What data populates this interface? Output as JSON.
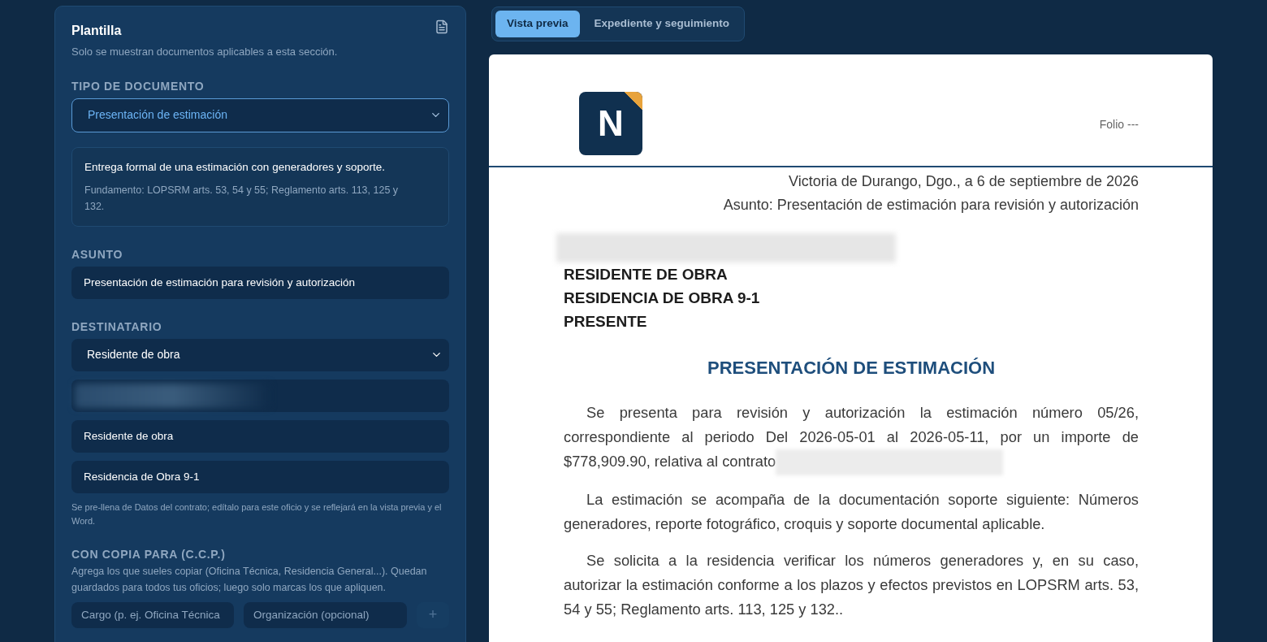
{
  "template_panel": {
    "title": "Plantilla",
    "subtitle": "Solo se muestran documentos aplicables a esta sección.",
    "document_type": {
      "label": "TIPO DE DOCUMENTO",
      "value": "Presentación de estimación"
    },
    "description": {
      "summary": "Entrega formal de una estimación con generadores y soporte.",
      "basis": "Fundamento: LOPSRM arts. 53, 54 y 55; Reglamento arts. 113, 125 y 132."
    },
    "subject": {
      "label": "ASUNTO",
      "value": "Presentación de estimación para revisión y autorización"
    },
    "recipient": {
      "label": "DESTINATARIO",
      "select_value": "Residente de obra",
      "fields": [
        {
          "kind": "redacted"
        },
        {
          "kind": "text",
          "value": "Residente de obra"
        },
        {
          "kind": "text",
          "value": "Residencia de Obra 9-1"
        }
      ],
      "help": "Se pre-llena de Datos del contrato; edítalo para este oficio y se reflejará en la vista previa y el Word."
    },
    "cc": {
      "label": "CON COPIA PARA (C.C.P.)",
      "help": "Agrega los que sueles copiar (Oficina Técnica, Residencia General...). Quedan guardados para todos tus oficios; luego solo marcas los que apliquen.",
      "role_placeholder": "Cargo (p. ej. Oficina Técnica",
      "org_placeholder": "Organización (opcional)",
      "add_button": "+"
    }
  },
  "tabs": [
    {
      "label": "Vista previa",
      "selected": true
    },
    {
      "label": "Expediente y seguimiento",
      "selected": false
    }
  ],
  "document": {
    "logo_letter": "N",
    "folio": "Folio ---",
    "place_date": "Victoria de Durango, Dgo., a 6 de septiembre de 2026",
    "subject_line": "Asunto: Presentación de estimación para revisión y autorización",
    "addressee": [
      {
        "kind": "redacted"
      },
      {
        "kind": "text",
        "text": "RESIDENTE DE OBRA"
      },
      {
        "kind": "text",
        "text": "RESIDENCIA DE OBRA 9-1"
      },
      {
        "kind": "text",
        "text": "PRESENTE"
      }
    ],
    "heading": "PRESENTACIÓN DE ESTIMACIÓN",
    "paragraphs": [
      {
        "text": "Se presenta para revisión y autorización la estimación número 05/26, correspondiente al periodo Del 2026-05-01 al 2026-05-11, por un importe de $778,909.90, relativa al contrato",
        "redacted_tail": true
      },
      {
        "text": "La estimación se acompaña de la documentación soporte siguiente: Números generadores, reporte fotográfico, croquis y soporte documental aplicable.",
        "redacted_tail": false
      },
      {
        "text": "Se solicita a la residencia verificar los números generadores y, en su caso, autorizar la estimación conforme a los plazos y efectos previstos en LOPSRM arts. 53, 54 y 55; Reglamento arts. 113, 125 y 132..",
        "redacted_tail": false
      }
    ]
  }
}
